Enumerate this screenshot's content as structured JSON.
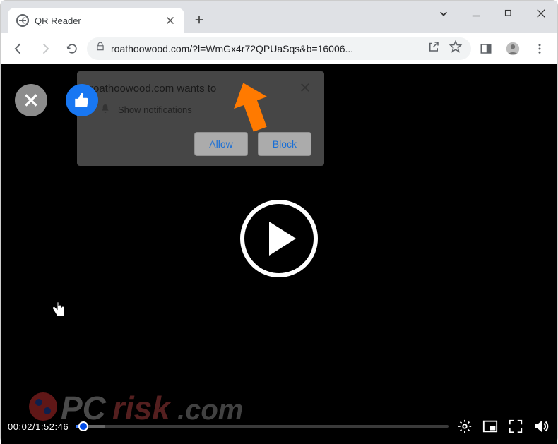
{
  "window": {
    "tab_title": "QR Reader"
  },
  "toolbar": {
    "url_display": "roathoowood.com/?l=WmGx4r72QPUaSqs&b=16006..."
  },
  "notification": {
    "title": "roathoowood.com wants to",
    "subtext": "Show notifications",
    "allow": "Allow",
    "block": "Block"
  },
  "video": {
    "current_time": "00:02",
    "total_time": "1:52:46"
  },
  "watermark": {
    "text": "PCrisk.com"
  },
  "icons": {
    "close_x": "×",
    "plus": "+"
  }
}
